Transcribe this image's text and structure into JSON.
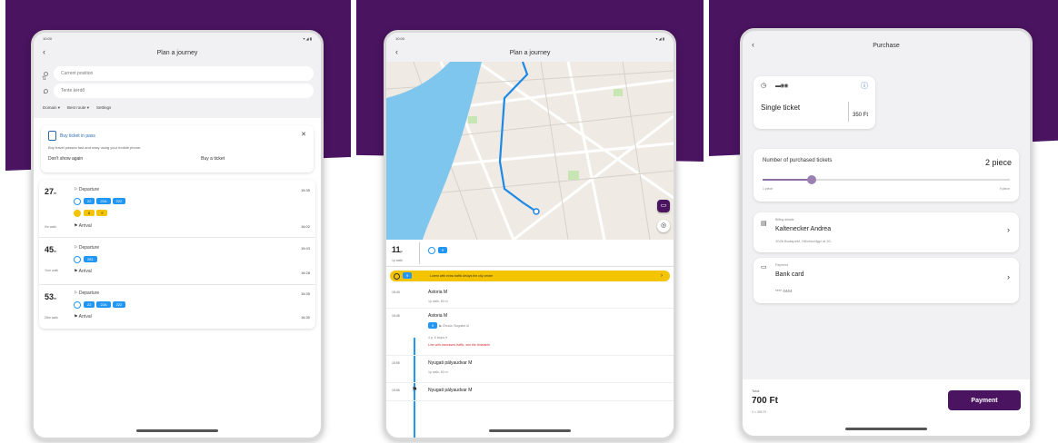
{
  "panel1": {
    "status_time": "10:00",
    "status_right": "▾ ◢ ▮",
    "title": "Plan a journey",
    "from_placeholder": "Current position",
    "to_placeholder": "Tente kérdő",
    "opts": [
      "Domain ▾",
      "Best route ▾",
      "Settings"
    ],
    "promo": {
      "title": "Buy ticket in pass",
      "desc": "Buy travel passes fast and easy using your mobile phone.",
      "dismiss": "Don't show again",
      "buy": "Buy a ticket"
    },
    "routes": [
      {
        "mins": "27",
        "unit": "m",
        "walk": "9m walk",
        "dep": "Departure",
        "dep_time": "15:35",
        "arr": "Arrival",
        "arr_time": "16:02",
        "chips": [
          "22",
          "22A",
          "222"
        ],
        "ychips": [
          "8",
          "9"
        ]
      },
      {
        "mins": "45",
        "unit": "m",
        "walk": "Your walk",
        "dep": "Departure",
        "dep_time": "15:43",
        "arr": "Arrival",
        "arr_time": "16:28",
        "chips": [
          "281"
        ],
        "ychips": []
      },
      {
        "mins": "53",
        "unit": "m",
        "walk": "28m walk",
        "dep": "Departure",
        "dep_time": "15:35",
        "arr": "Arrival",
        "arr_time": "16:30",
        "chips": [
          "22",
          "22A",
          "222"
        ],
        "ychips": []
      }
    ]
  },
  "panel2": {
    "status_time": "10:00",
    "status_right": "▾ ◢ ▮",
    "title": "Plan a journey",
    "summary_mins": "11",
    "summary_unit": "p",
    "summary_sub": "1p walk",
    "chip": "9",
    "warning": "Lorem with extra traffic delays the city center",
    "legs": [
      {
        "time": "15:43",
        "stop": "Astoria M",
        "sub": "1p walk, 80 m"
      },
      {
        "time": "15:45",
        "stop": "Astoria M",
        "sub": "▶ Óbuda, Bogdáni út"
      },
      {
        "time": "15:55",
        "stop": "Nyugati pályaudvar M",
        "sub": "1p walk, 50 m"
      },
      {
        "time": "15:56",
        "stop": "Nyugati pályaudvar M",
        "sub": ""
      }
    ],
    "leg2_line": "9",
    "leg2_note": "4 p, 5 stops ▾",
    "leg2_alert": "Line with increased traffic, see the timetable"
  },
  "panel3": {
    "title": "Purchase",
    "ticket_name": "Single ticket",
    "ticket_price": "350 Ft",
    "qty_label": "Number of purchased tickets",
    "qty_value": "2 piece",
    "qty_min": "1 piece",
    "qty_max": "9 piece",
    "billing_label": "Billing details",
    "billing_name": "Kaltenecker Andrea",
    "billing_addr": "1026 Budapest, Hűvösvölgyi út 20.",
    "payment_label": "Payment",
    "payment_name": "Bank card",
    "payment_card": "**** 4444",
    "total_label": "Total",
    "total_value": "700 Ft",
    "total_sub": "2 × 350 Ft",
    "pay_button": "Payment"
  },
  "colors": {
    "purple": "#4a1460",
    "blue": "#2196f3",
    "yellow": "#f5c400"
  }
}
